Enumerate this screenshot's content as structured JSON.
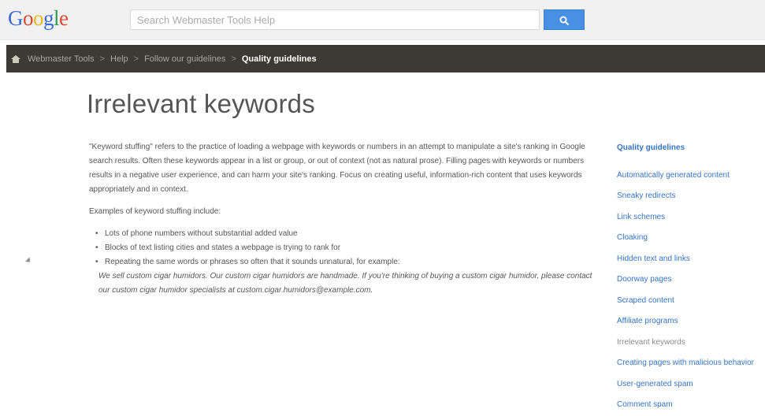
{
  "header": {
    "logo_letters": [
      {
        "char": "G",
        "color": "#3b6bd6"
      },
      {
        "char": "o",
        "color": "#d84a38"
      },
      {
        "char": "o",
        "color": "#e8b820"
      },
      {
        "char": "g",
        "color": "#3b6bd6"
      },
      {
        "char": "l",
        "color": "#2f9a4b"
      },
      {
        "char": "e",
        "color": "#d84a38"
      }
    ],
    "search_placeholder": "Search Webmaster Tools Help",
    "search_button_icon": "search-icon"
  },
  "breadcrumb": {
    "home_icon": "home-icon",
    "items": [
      "Webmaster Tools",
      "Help",
      "Follow our guidelines"
    ],
    "separator": ">",
    "current": "Quality guidelines"
  },
  "article": {
    "title": "Irrelevant keywords",
    "intro": "\"Keyword stuffing\" refers to the practice of loading a webpage with keywords or numbers in an attempt to manipulate a site's ranking in Google search results. Often these keywords appear in a list or group, or out of context (not as natural prose). Filling pages with keywords or numbers results in a negative user experience, and can harm your site's ranking. Focus on creating useful, information-rich content that uses keywords appropriately and in context.",
    "examples_label": "Examples of keyword stuffing include:",
    "bullets": [
      "Lots of phone numbers without substantial added value",
      "Blocks of text listing cities and states a webpage is trying to rank for",
      "Repeating the same words or phrases so often that it sounds unnatural, for example:"
    ],
    "example_text": "We sell custom cigar humidors. Our custom cigar humidors are handmade. If you're thinking of buying a custom cigar humidor, please contact our custom cigar humidor specialists at custom.cigar.humidors@example.com."
  },
  "sidebar": {
    "heading": "Quality guidelines",
    "items": [
      "Automatically generated content",
      "Sneaky redirects",
      "Link schemes",
      "Cloaking",
      "Hidden text and links",
      "Doorway pages",
      "Scraped content",
      "Affiliate programs",
      "Irrelevant keywords",
      "Creating pages with malicious behavior",
      "User-generated spam",
      "Comment spam"
    ],
    "current_item": "Irrelevant keywords"
  }
}
